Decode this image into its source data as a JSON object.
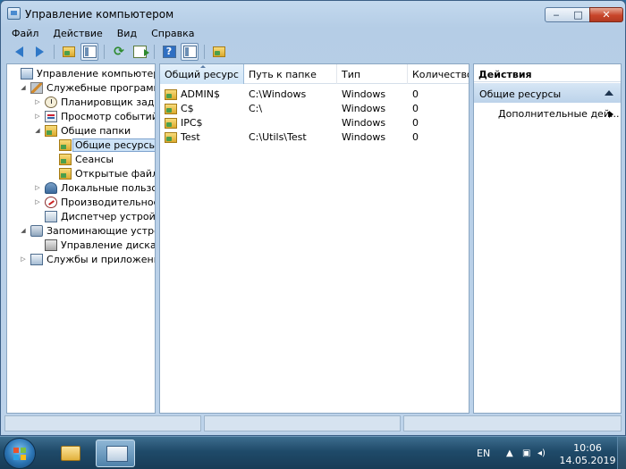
{
  "window": {
    "title": "Управление компьютером",
    "controls": {
      "minimize": "‒",
      "maximize": "□",
      "close": "✕"
    }
  },
  "menu": [
    "Файл",
    "Действие",
    "Вид",
    "Справка"
  ],
  "toolbar": {
    "icons": [
      "back-arrow-icon",
      "forward-arrow-icon",
      "up-folder-icon",
      "show-hide-tree-icon",
      "refresh-icon",
      "export-list-icon",
      "help-icon",
      "show-hide-action-pane-icon",
      "new-share-icon"
    ],
    "help_glyph": "?"
  },
  "tree": {
    "items": [
      {
        "label": "Управление компьютером (л",
        "level": 0,
        "expander": "",
        "icon": "computer"
      },
      {
        "label": "Служебные программы",
        "level": 1,
        "expander": "◢",
        "icon": "tools"
      },
      {
        "label": "Планировщик заданий",
        "level": 2,
        "expander": "▷",
        "icon": "clock"
      },
      {
        "label": "Просмотр событий",
        "level": 2,
        "expander": "▷",
        "icon": "events"
      },
      {
        "label": "Общие папки",
        "level": 2,
        "expander": "◢",
        "icon": "share"
      },
      {
        "label": "Общие ресурсы",
        "level": 3,
        "expander": "",
        "icon": "share",
        "selected": true
      },
      {
        "label": "Сеансы",
        "level": 3,
        "expander": "",
        "icon": "share"
      },
      {
        "label": "Открытые файлы",
        "level": 3,
        "expander": "",
        "icon": "share"
      },
      {
        "label": "Локальные пользовате",
        "level": 2,
        "expander": "▷",
        "icon": "users"
      },
      {
        "label": "Производительность",
        "level": 2,
        "expander": "▷",
        "icon": "perf"
      },
      {
        "label": "Диспетчер устройств",
        "level": 2,
        "expander": "",
        "icon": "device"
      },
      {
        "label": "Запоминающие устройст",
        "level": 1,
        "expander": "◢",
        "icon": "storage"
      },
      {
        "label": "Управление дисками",
        "level": 2,
        "expander": "",
        "icon": "disk"
      },
      {
        "label": "Службы и приложения",
        "level": 1,
        "expander": "▷",
        "icon": "services"
      }
    ]
  },
  "list": {
    "columns": [
      "Общий ресурс",
      "Путь к папке",
      "Тип",
      "Количество к"
    ],
    "rows": [
      [
        "ADMIN$",
        "C:\\Windows",
        "Windows",
        "0"
      ],
      [
        "C$",
        "C:\\",
        "Windows",
        "0"
      ],
      [
        "IPC$",
        "",
        "Windows",
        "0"
      ],
      [
        "Test",
        "C:\\Utils\\Test",
        "Windows",
        "0"
      ]
    ]
  },
  "actions": {
    "header": "Действия",
    "group": "Общие ресурсы",
    "item": "Дополнительные дей..."
  },
  "taskbar": {
    "lang": "EN",
    "tray_icons": [
      "▲",
      "▣",
      "◂)"
    ],
    "time": "10:06",
    "date": "14.05.2019"
  },
  "colors": {
    "accent": "#2f78c7",
    "selection": "#cde3f7",
    "taskbar": "#1f4a69"
  }
}
